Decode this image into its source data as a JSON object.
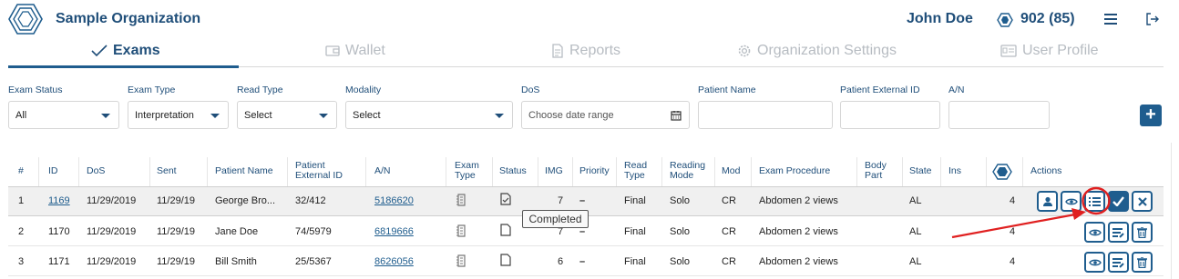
{
  "header": {
    "org_name": "Sample Organization",
    "user_name": "John Doe",
    "credits": "902 (85)",
    "logo_icon": "hexagon-logo-icon",
    "credits_icon": "hexagon-coin-icon",
    "menu_icon": "hamburger-menu-icon",
    "logout_icon": "logout-icon"
  },
  "tabs": [
    {
      "label": "Exams",
      "icon": "check-icon",
      "active": true
    },
    {
      "label": "Wallet",
      "icon": "wallet-icon",
      "active": false
    },
    {
      "label": "Reports",
      "icon": "report-icon",
      "active": false
    },
    {
      "label": "Organization Settings",
      "icon": "gear-icon",
      "active": false
    },
    {
      "label": "User Profile",
      "icon": "id-card-icon",
      "active": false
    }
  ],
  "filters": {
    "exam_status": {
      "label": "Exam Status",
      "value": "All"
    },
    "exam_type": {
      "label": "Exam Type",
      "value": "Interpretation"
    },
    "read_type": {
      "label": "Read Type",
      "value": "Select"
    },
    "modality": {
      "label": "Modality",
      "value": "Select"
    },
    "dos": {
      "label": "DoS",
      "placeholder": "Choose date range"
    },
    "patient_name": {
      "label": "Patient Name",
      "value": ""
    },
    "patient_external_id": {
      "label": "Patient External ID",
      "value": ""
    },
    "an": {
      "label": "A/N",
      "value": ""
    },
    "add_label": "+"
  },
  "table": {
    "headers": {
      "num": "#",
      "id": "ID",
      "dos": "DoS",
      "sent": "Sent",
      "patient_name": "Patient Name",
      "patient_ext_1": "Patient",
      "patient_ext_2": "External ID",
      "an": "A/N",
      "exam_type_1": "Exam",
      "exam_type_2": "Type",
      "status": "Status",
      "img": "IMG",
      "priority": "Priority",
      "read_type_1": "Read",
      "read_type_2": "Type",
      "reading_mode_1": "Reading",
      "reading_mode_2": "Mode",
      "mod": "Mod",
      "exam_procedure": "Exam Procedure",
      "body_part_1": "Body",
      "body_part_2": "Part",
      "state": "State",
      "ins": "Ins",
      "actions": "Actions"
    },
    "rows": [
      {
        "num": "1",
        "id": "1169",
        "dos": "11/29/2019",
        "sent": "11/29/19",
        "patient_name": "George Bro...",
        "patient_external_id": "32/412",
        "an": "5186620",
        "status_icon": "document-check-icon",
        "img": "7",
        "priority": "–",
        "read_type": "Final",
        "reading_mode": "Solo",
        "mod": "CR",
        "exam_procedure": "Abdomen 2 views",
        "body_part": "",
        "state": "AL",
        "ins": "",
        "credits": "4"
      },
      {
        "num": "2",
        "id": "1170",
        "dos": "11/29/2019",
        "sent": "11/29/19",
        "patient_name": "Jane Doe",
        "patient_external_id": "74/5979",
        "an": "6819666",
        "status_icon": "document-icon",
        "img": "7",
        "priority": "–",
        "read_type": "Final",
        "reading_mode": "Solo",
        "mod": "CR",
        "exam_procedure": "Abdomen 2 views",
        "body_part": "",
        "state": "AL",
        "ins": "",
        "credits": "4"
      },
      {
        "num": "3",
        "id": "1171",
        "dos": "11/29/2019",
        "sent": "11/29/19",
        "patient_name": "Bill Smith",
        "patient_external_id": "25/5367",
        "an": "8626056",
        "status_icon": "document-icon",
        "img": "6",
        "priority": "–",
        "read_type": "Final",
        "reading_mode": "Solo",
        "mod": "CR",
        "exam_procedure": "Abdomen 2 views",
        "body_part": "",
        "state": "AL",
        "ins": "",
        "credits": "4"
      }
    ]
  },
  "tooltip": {
    "text": "Completed"
  },
  "colors": {
    "primary": "#1f5d8e",
    "heading": "#1f4e79",
    "highlight_row": "#f0f0f0",
    "annotation_red": "#e02020"
  }
}
